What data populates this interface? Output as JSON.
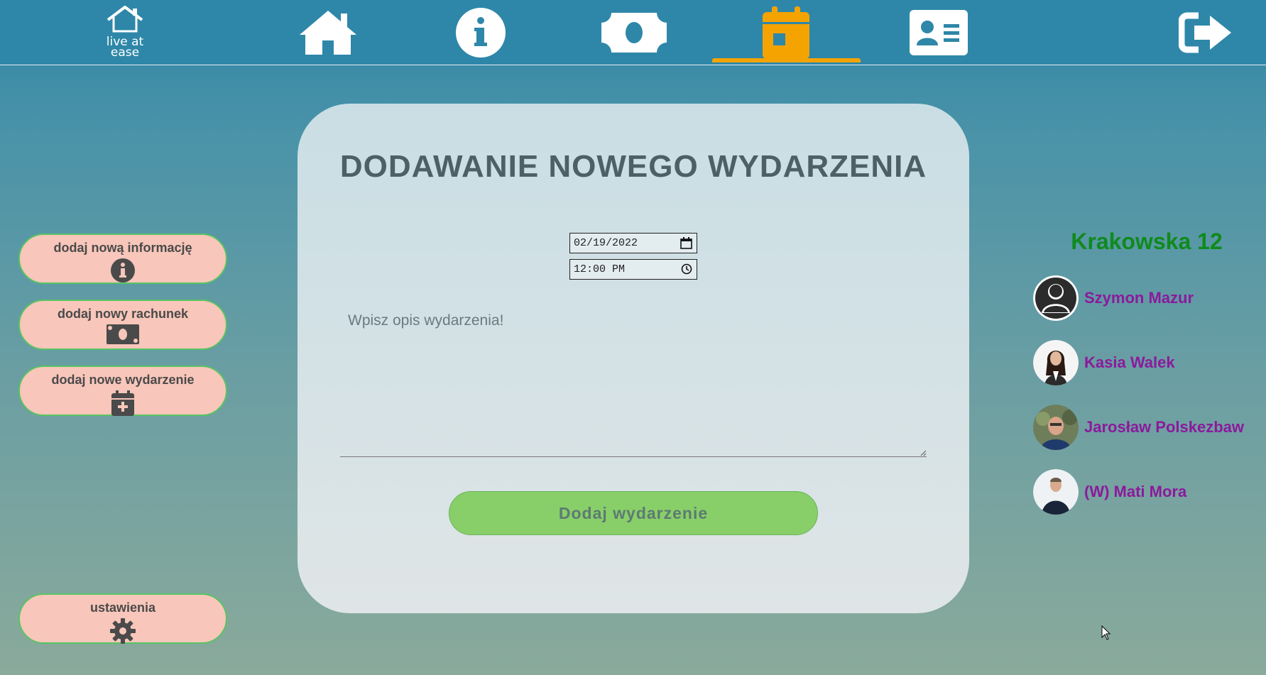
{
  "nav": {
    "logo_text": [
      "live at",
      "ease"
    ],
    "items": [
      {
        "name": "home",
        "icon": "home-icon"
      },
      {
        "name": "info",
        "icon": "info-circle-icon"
      },
      {
        "name": "bills",
        "icon": "money-bill-icon"
      },
      {
        "name": "events",
        "icon": "calendar-icon",
        "active": true
      },
      {
        "name": "profile",
        "icon": "id-card-icon"
      },
      {
        "name": "logout",
        "icon": "sign-out-icon"
      }
    ],
    "active_color": "#f5a300"
  },
  "sidebar": {
    "items": [
      {
        "label": "dodaj nową informację",
        "icon": "info-circle-icon"
      },
      {
        "label": "dodaj nowy rachunek",
        "icon": "money-bill-icon"
      },
      {
        "label": "dodaj nowe wydarzenie",
        "icon": "calendar-plus-icon"
      },
      {
        "label": "ustawienia",
        "icon": "gear-icon"
      }
    ]
  },
  "form": {
    "title": "DODAWANIE NOWEGO WYDARZENIA",
    "date_value": "02/19/2022",
    "time_value": "12:00 PM",
    "description_placeholder": "Wpisz opis wydarzenia!",
    "submit_label": "Dodaj wydarzenie"
  },
  "household": {
    "address": "Krakowska 12",
    "members": [
      {
        "name": "Szymon Mazur",
        "avatar": "default-avatar-icon"
      },
      {
        "name": "Kasia Walek",
        "avatar": "photo-avatar"
      },
      {
        "name": "Jarosław Polskezbaw",
        "avatar": "photo-avatar"
      },
      {
        "name": "(W) Mati Mora",
        "avatar": "photo-avatar"
      }
    ]
  },
  "colors": {
    "accent": "#f5a300",
    "button_bg": "#f8c6ba",
    "button_border": "#59c463",
    "submit_bg": "#88cf69",
    "address": "#0f8a1d",
    "member_name": "#8b1a9c"
  }
}
